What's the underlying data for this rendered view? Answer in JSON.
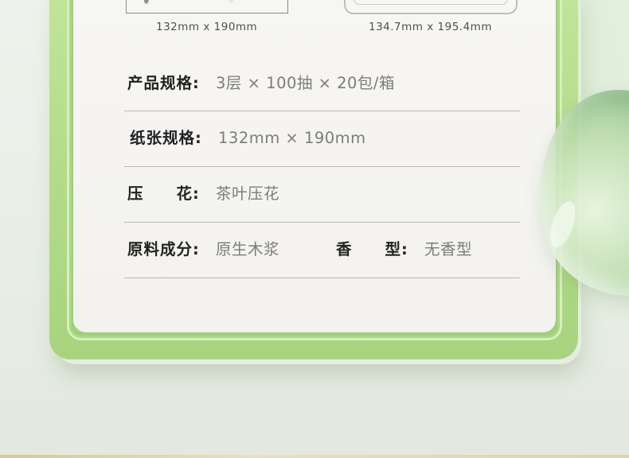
{
  "packaging": {
    "left_size": "132mm x 190mm",
    "right_size": "134.7mm x 195.4mm"
  },
  "specs": [
    {
      "label": "产品规格:",
      "value": "3层 × 100抽 × 20包/箱"
    },
    {
      "label": "纸张规格:",
      "value": "132mm × 190mm"
    },
    {
      "label": "压　　花:",
      "value": "茶叶压花"
    },
    {
      "label": "原料成分:",
      "value": "原生木浆",
      "label2": "香　　型:",
      "value2": "无香型"
    }
  ],
  "colors": {
    "frame": "#b3dc8a",
    "card": "#f5f4f1",
    "label": "#222222",
    "value": "#7c7c7c"
  }
}
